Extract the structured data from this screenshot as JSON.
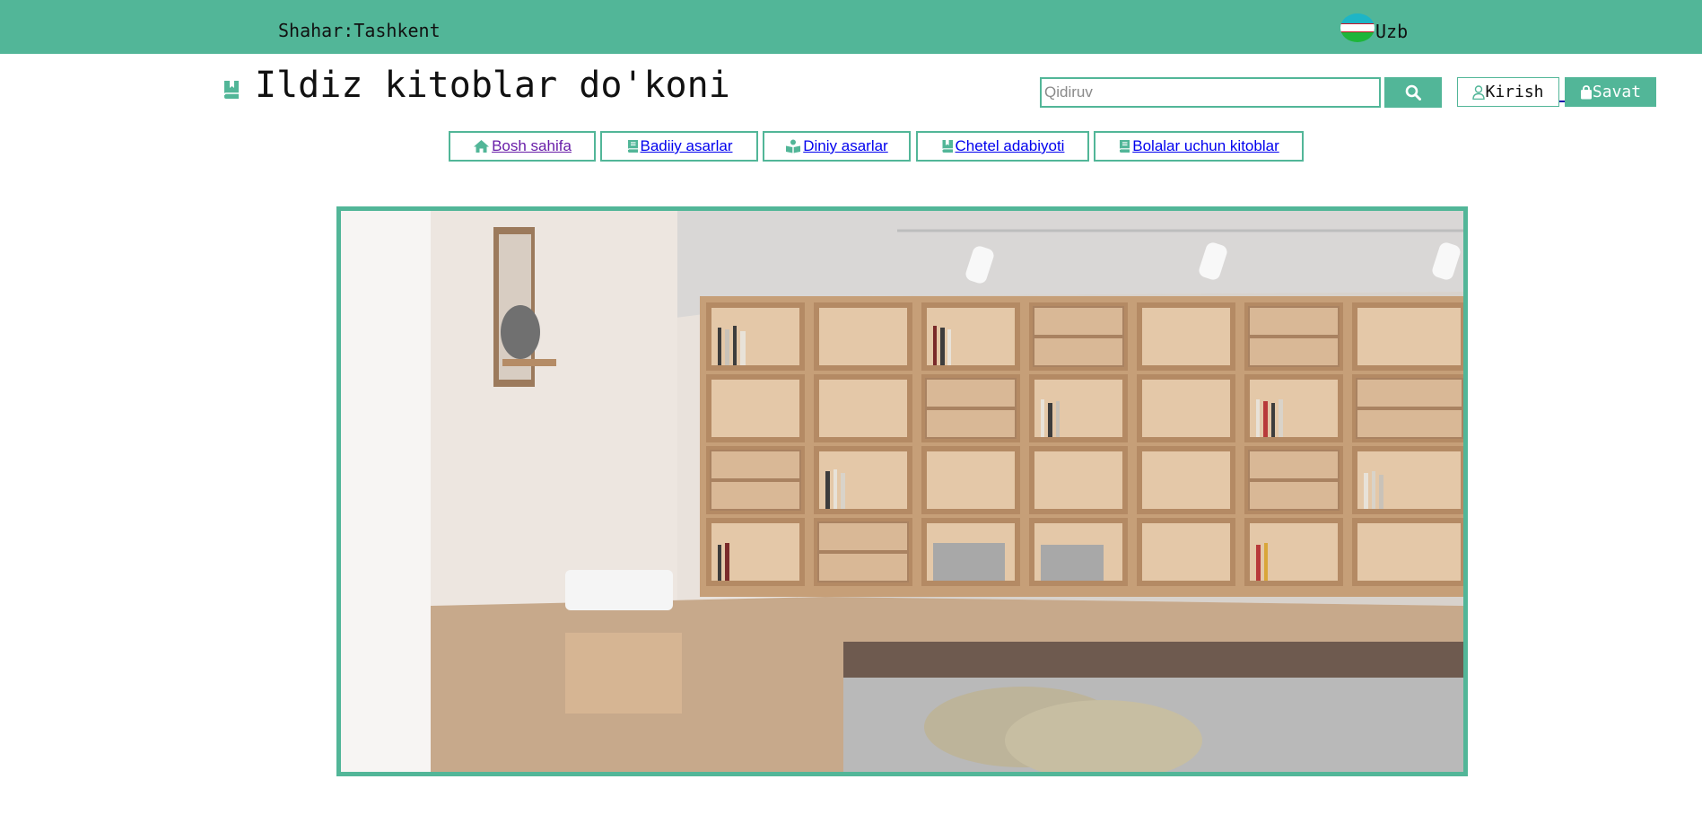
{
  "colors": {
    "accent": "#52b698",
    "visited_link": "#681da8",
    "link": "#0000ee"
  },
  "topbar": {
    "city": "Shahar:Tashkent",
    "language": "Uzb",
    "flag_icon": "uzbekistan-flag-icon"
  },
  "header": {
    "logo_icon": "book-bookmark-icon",
    "title": "Ildiz kitoblar do'koni"
  },
  "search": {
    "placeholder": "Qidiruv",
    "value": "",
    "icon": "search-icon"
  },
  "account": {
    "login_label": "Kirish",
    "login_icon": "user-icon",
    "cart_label": "Savat",
    "cart_icon": "shopping-bag-icon"
  },
  "nav": {
    "items": [
      {
        "label": " Bosh sahifa",
        "icon": "home-icon"
      },
      {
        "label": " Badiiy asarlar",
        "icon": "book-icon"
      },
      {
        "label": " Diniy asarlar",
        "icon": "book-reader-icon"
      },
      {
        "label": " Chetel adabiyoti",
        "icon": "book-bookmark-icon"
      },
      {
        "label": " Bolalar uchun kitoblar",
        "icon": "book-icon"
      }
    ]
  },
  "hero": {
    "image_icon": "bookshelf-interior-photo"
  }
}
